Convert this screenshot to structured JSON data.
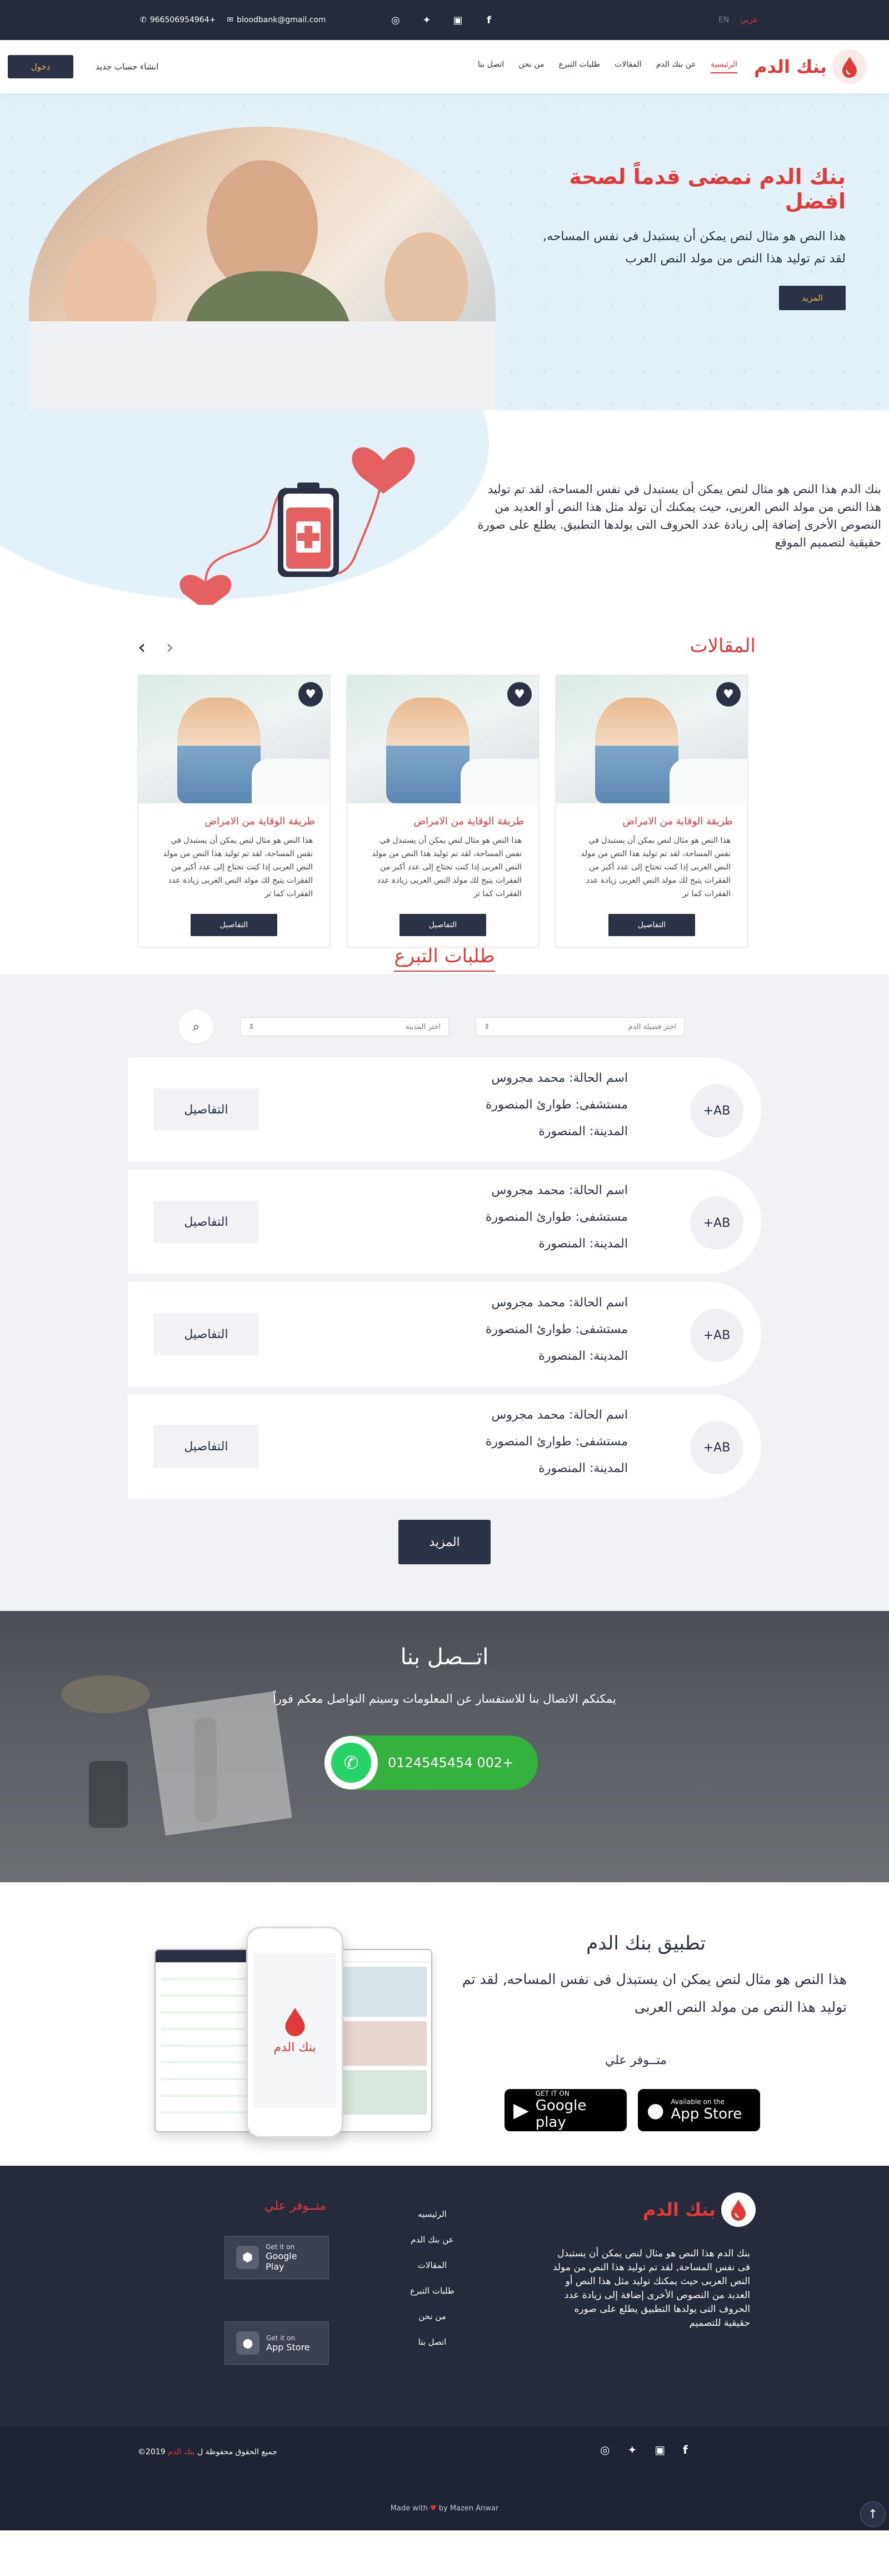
{
  "topbar": {
    "phone": "966506954964+",
    "email": "bloodbank@gmail.com",
    "lang_ar": "عربي",
    "lang_en": "EN"
  },
  "nav": {
    "brand": "بنك الدم",
    "menu": [
      "الرئيسية",
      "عن بنك الدم",
      "المقالات",
      "طلبات التبرع",
      "من نحن",
      "اتصل بنا"
    ],
    "register": "انشاء حساب جديد",
    "login": "دخول"
  },
  "hero": {
    "title": "بنك الدم نمضى قدماً لصحة افضل",
    "line1": "هذا النص هو مثال لنص يمكن أن يستبدل فى نفس المساحه,",
    "line2": "لقد تم توليد هذا النص من مولد النص العرب",
    "button": "المزيد"
  },
  "about": {
    "text": "بنك الدم هذا النص هو مثال لنص يمكن أن يستبدل في نفس المساحة، لقد تم توليد هذا النص من مولد النص العربى، حيث يمكنك أن تولد مثل هذا النص أو العديد من النصوص الأخرى إضافة إلى زيادة عدد الحروف التى يولدها التطبيق. يطلع على صورة حقيقية لتصميم الموقع"
  },
  "articles": {
    "title": "المقالات",
    "items": [
      {
        "title": "طريقة الوقاية من الامراض",
        "body": "هذا النص هو مثال لنص يمكن أن يستبدل في نفس المساحة، لقد تم توليد هذا النص من مولد النص العربى إذا كنت تحتاج إلى عدد أكبر من الفقرات يتيح لك مولد النص العربى زيادة عدد الفقرات كما تر",
        "button": "التفاصيل"
      },
      {
        "title": "طريقة الوقاية من الامراض",
        "body": "هذا النص هو مثال لنص يمكن أن يستبدل في نفس المساحة، لقد تم توليد هذا النص من مولد النص العربى إذا كنت تحتاج إلى عدد أكبر من الفقرات يتيح لك مولد النص العربى زيادة عدد الفقرات كما تر",
        "button": "التفاصيل"
      },
      {
        "title": "طريقة الوقاية من الامراض",
        "body": "هذا النص هو مثال لنص يمكن أن يستبدل في نفس المساحة، لقد تم توليد هذا النص من مولد النص العربى إذا كنت تحتاج إلى عدد أكبر من الفقرات يتيح لك مولد النص العربى زيادة عدد الفقرات كما تر",
        "button": "التفاصيل"
      }
    ]
  },
  "requests": {
    "title": "طلبات التبرع",
    "blood_select": "اختر فصيلة الدم",
    "city_select": "اختر المدينة",
    "items": [
      {
        "blood": "AB+",
        "name": "اسم الحالة: محمد مجروس",
        "hospital": "مستشفى: طوارئ المنصورة",
        "city": "المدينة: المنصورة",
        "button": "التفاصيل"
      },
      {
        "blood": "AB+",
        "name": "اسم الحالة: محمد مجروس",
        "hospital": "مستشفى: طوارئ المنصورة",
        "city": "المدينة: المنصورة",
        "button": "التفاصيل"
      },
      {
        "blood": "AB+",
        "name": "اسم الحالة: محمد مجروس",
        "hospital": "مستشفى: طوارئ المنصورة",
        "city": "المدينة: المنصورة",
        "button": "التفاصيل"
      },
      {
        "blood": "AB+",
        "name": "اسم الحالة: محمد مجروس",
        "hospital": "مستشفى: طوارئ المنصورة",
        "city": "المدينة: المنصورة",
        "button": "التفاصيل"
      }
    ],
    "more": "المزيد"
  },
  "contact": {
    "title": "اتــصل بنا",
    "subtitle": "يمكنكم الاتصال بنا للاستفسار عن المعلومات وسيتم التواصل معكم فوراً",
    "whatsapp": "0124545454 002+"
  },
  "app": {
    "title": "تطبيق بنك الدم",
    "text": "هذا النص هو مثال لنص يمكن ان يستبدل فى نفس المساحه, لقد تم توليد هذا النص من مولد النص العربى",
    "available": "متــوفر علي",
    "appstore_small": "Available on the",
    "appstore_big": "App Store",
    "play_small": "GET IT ON",
    "play_big": "Google play",
    "phone_brand": "بنك الدم"
  },
  "footer": {
    "brand": "بنك الدم",
    "about": "بنك الدم هذا النص هو مثال لنص يمكن أن يستبدل فى نفس المساحة, لقد تم توليد هذا النص من مولد النص العربى حيث يمكنك توليد مثل هذا النص أو العديد من النصوص الأخرى إضافة إلى زيادة عدد الحروف التى يولدها التطبيق يطلع على صوره حقيقية للتصميم",
    "links": [
      "الرئيسيه",
      "عن بنك الدم",
      "المقالات",
      "طلبات التبرع",
      "من نحن",
      "اتصل بنا"
    ],
    "available": "متــوفر علي",
    "play_small": "Get it on",
    "play_big": "Google Play",
    "appstore_small": "Get it on",
    "appstore_big": "App Store",
    "copyright_prefix": "جميع الحقوق محفوظة ل",
    "copyright_brand": "بنك الدم",
    "copyright_year": "2019©",
    "made_prefix": "Made with",
    "made_suffix": "by Mazen Anwar"
  },
  "colors": {
    "accent": "#e03b3b",
    "navy": "#252b3b",
    "button": "#2b3246",
    "whatsapp": "#34b23d",
    "hero_bg": "#e3f1f8"
  }
}
